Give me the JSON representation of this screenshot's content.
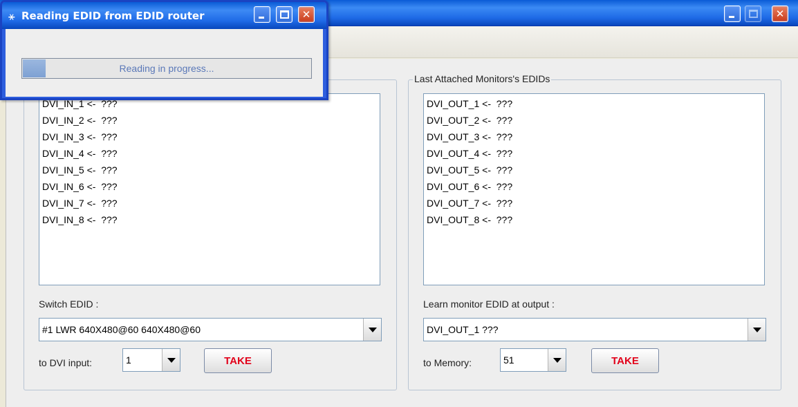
{
  "dialog": {
    "title": "Reading EDID from EDID router",
    "progress_text": "Reading in progress...",
    "progress_fraction": 0.08
  },
  "left_panel": {
    "rows": [
      "DVI_IN_1 <-  ???",
      "DVI_IN_2 <-  ???",
      "DVI_IN_3 <-  ???",
      "DVI_IN_4 <-  ???",
      "DVI_IN_5 <-  ???",
      "DVI_IN_6 <-  ???",
      "DVI_IN_7 <-  ???",
      "DVI_IN_8 <-  ???"
    ],
    "switch_label": "Switch EDID :",
    "switch_value": "#1 LWR 640X480@60 640X480@60",
    "input_label": "to DVI input:",
    "input_value": "1",
    "take_label": "TAKE"
  },
  "right_panel": {
    "legend": "Last Attached Monitors's EDIDs",
    "rows": [
      "DVI_OUT_1 <-  ???",
      "DVI_OUT_2 <-  ???",
      "DVI_OUT_3 <-  ???",
      "DVI_OUT_4 <-  ???",
      "DVI_OUT_5 <-  ???",
      "DVI_OUT_6 <-  ???",
      "DVI_OUT_7 <-  ???",
      "DVI_OUT_8 <-  ???"
    ],
    "learn_label": "Learn monitor EDID at output :",
    "learn_value": "DVI_OUT_1 ???",
    "memory_label": "to Memory:",
    "memory_value": "51",
    "take_label": "TAKE"
  }
}
